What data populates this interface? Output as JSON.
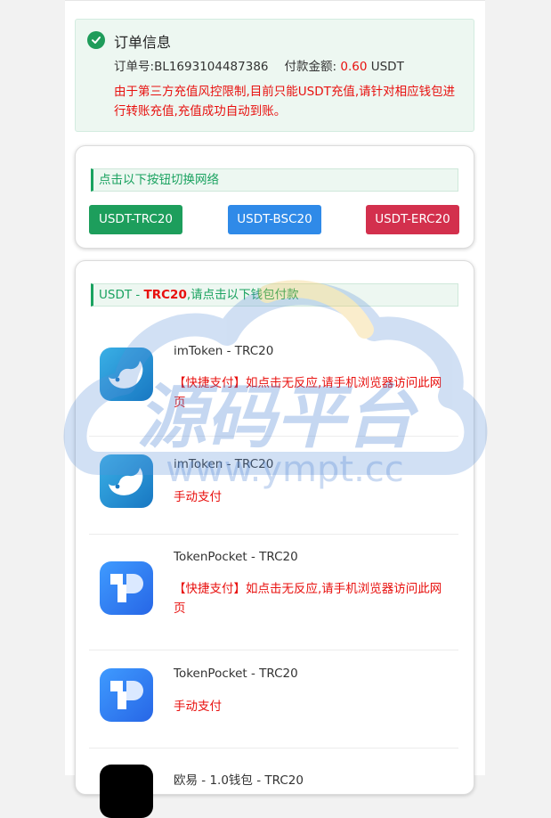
{
  "order": {
    "title": "订单信息",
    "order_no_label": "订单号:",
    "order_no": "BL1693104487386",
    "amount_label": "付款金额:",
    "amount": "0.60",
    "currency": "USDT",
    "notice": "由于第三方充值风控限制,目前只能USDT充值,请针对相应钱包进行转账充值,充值成功自动到账。"
  },
  "network": {
    "prompt": "点击以下按钮切换网络",
    "buttons": [
      {
        "label": "USDT-TRC20"
      },
      {
        "label": "USDT-BSC20"
      },
      {
        "label": "USDT-ERC20"
      }
    ]
  },
  "wallets": {
    "prompt_prefix": "USDT - ",
    "prompt_network": "TRC20",
    "prompt_suffix": ",请点击以下钱包付款",
    "items": [
      {
        "name": "imToken - TRC20",
        "desc": "【快捷支付】如点击无反应,请手机浏览器访问此网页",
        "icon": "imtoken-icon"
      },
      {
        "name": "imToken - TRC20",
        "desc": "手动支付",
        "icon": "imtoken-icon"
      },
      {
        "name": "TokenPocket - TRC20",
        "desc": "【快捷支付】如点击无反应,请手机浏览器访问此网页",
        "icon": "tokenpocket-icon"
      },
      {
        "name": "TokenPocket - TRC20",
        "desc": "手动支付",
        "icon": "tokenpocket-icon"
      },
      {
        "name": "欧易 - 1.0钱包 - TRC20",
        "desc": "",
        "icon": "okx-icon"
      }
    ]
  },
  "watermark": {
    "text_cn": "源码平台",
    "text_url": "www.ympt.cc"
  },
  "colors": {
    "green": "#1d9e5c",
    "blue": "#2f8ae8",
    "red": "#d3304d",
    "warning_text": "#e8110f"
  }
}
